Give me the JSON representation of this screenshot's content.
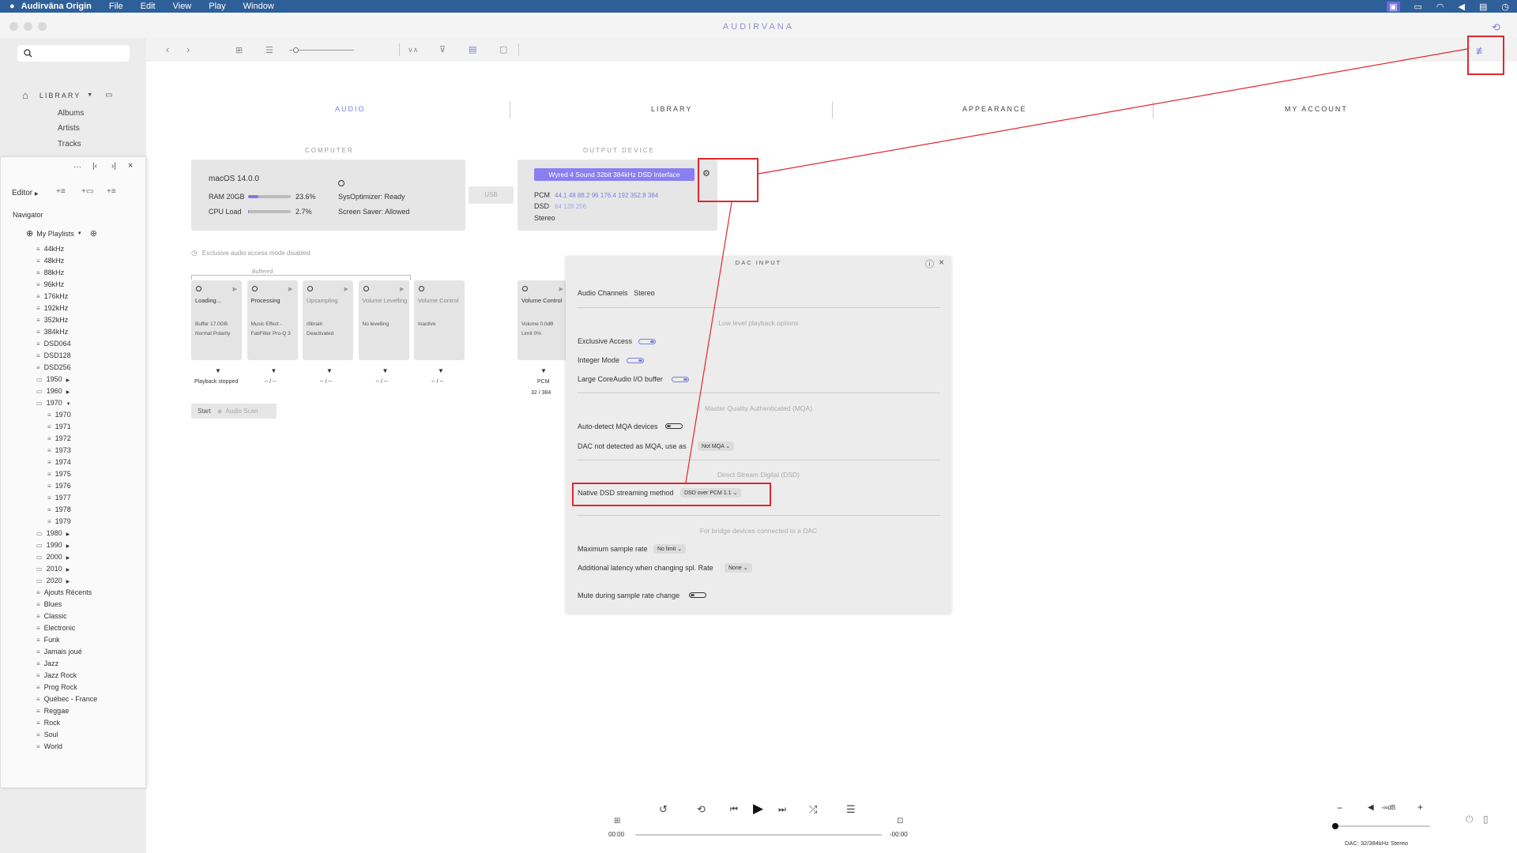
{
  "menubar": {
    "apple": "",
    "app": "Audirvāna Origin",
    "items": [
      "File",
      "Edit",
      "View",
      "Play",
      "Window"
    ]
  },
  "window": {
    "title": "AUDIRVANA"
  },
  "sidebar": {
    "library_label": "LIBRARY",
    "nav": [
      "Albums",
      "Artists",
      "Tracks"
    ]
  },
  "editor": {
    "title": "Editor",
    "navigator": "Navigator",
    "my_playlists": "My Playlists",
    "playlists": [
      "44kHz",
      "48kHz",
      "88kHz",
      "96kHz",
      "176kHz",
      "192kHz",
      "352kHz",
      "384kHz",
      "DSD064",
      "DSD128",
      "DSD256"
    ],
    "folders_1": [
      "1950",
      "1960",
      "1970"
    ],
    "folder_1970_items": [
      "1970",
      "1971",
      "1972",
      "1973",
      "1974",
      "1975",
      "1976",
      "1977",
      "1978",
      "1979"
    ],
    "folders_2": [
      "1980",
      "1990",
      "2000",
      "2010",
      "2020"
    ],
    "genres": [
      "Ajouts Récents",
      "Blues",
      "Classic",
      "Electronic",
      "Funk",
      "Jamais joué",
      "Jazz",
      "Jazz Rock",
      "Prog Rock",
      "Québec - France",
      "Reggae",
      "Rock",
      "Soul",
      "World"
    ]
  },
  "tabs": [
    "AUDIO",
    "LIBRARY",
    "APPEARANCE",
    "MY ACCOUNT"
  ],
  "computer": {
    "section": "COMPUTER",
    "os": "macOS 14.0.0",
    "ram_label": "RAM 20GB",
    "ram_value": "23.6%",
    "ram_fraction": 0.236,
    "cpu_label": "CPU Load",
    "cpu_value": "2.7%",
    "cpu_fraction": 0.027,
    "sysopt": "SysOptimizer: Ready",
    "screensaver": "Screen Saver: Allowed"
  },
  "usb_label": "USB",
  "output": {
    "section": "OUTPUT DEVICE",
    "device": "Wyred 4 Sound 32bit 384kHz DSD Interface",
    "pcm_label": "PCM",
    "pcm_rates": "44.1 48 88.2 96 176.4 192 352.8 384",
    "dsd_label": "DSD",
    "dsd_rates": "64 128 256",
    "channels": "Stereo"
  },
  "exclusive_note": "Exclusive audio access mode disabled",
  "buffered_label": "Buffered",
  "pipeline": [
    {
      "name": "Loading...",
      "l1": "Buffer 17.0GB",
      "l2": "Normal Polarity",
      "under": "Playback stopped",
      "dim": false
    },
    {
      "name": "Processing",
      "l1": "Music Effect -",
      "l2": "FabFilter Pro-Q 3",
      "under": "-- / --",
      "dim": false
    },
    {
      "name": "Upsampling",
      "l1": "r8brain",
      "l2": "Deactivated",
      "under": "-- / --",
      "dim": true
    },
    {
      "name": "Volume Levelling",
      "l1": "No levelling",
      "l2": "",
      "under": "-- / --",
      "dim": true
    },
    {
      "name": "Volume Control",
      "l1": "Inactive",
      "l2": "",
      "under": "-- / --",
      "dim": true
    }
  ],
  "out_pipe": {
    "name": "Volume Control",
    "l1": "Volume 0.0dB",
    "l2": "Limit 0%",
    "under1": "PCM",
    "under2": "32 / 384"
  },
  "start_label": "Start",
  "audioscan_label": "Audio Scan",
  "dac": {
    "title": "DAC INPUT",
    "audio_channels_label": "Audio Channels",
    "audio_channels_value": "Stereo",
    "low_level": "Low level playback options",
    "exclusive": "Exclusive Access",
    "integer": "Integer Mode",
    "large_buffer": "Large CoreAudio I/O buffer",
    "mqa_section": "Master Quality Authenticated (MQA)",
    "mqa_auto": "Auto-detect MQA devices",
    "mqa_not_detected": "DAC not detected as MQA, use as",
    "mqa_select": "Not MQA",
    "dsd_section": "Direct Stream Digital (DSD)",
    "dsd_method": "Native DSD streaming method",
    "dsd_select": "DSD over PCM 1.1",
    "bridge_section": "For bridge devices connected to a DAC",
    "max_rate": "Maximum sample rate",
    "max_rate_select": "No limit",
    "latency": "Additional latency when changing spl. Rate",
    "latency_select": "None",
    "mute": "Mute during sample rate change"
  },
  "player": {
    "time_start": "00:00",
    "time_end": "-00:00",
    "volume": "-∞dB",
    "dac_status": "DAC: 32/384kHz Stereo"
  },
  "colors": {
    "accent": "#7c7ce0",
    "annotation": "#e0272f",
    "menubar": "#2f5f99"
  }
}
